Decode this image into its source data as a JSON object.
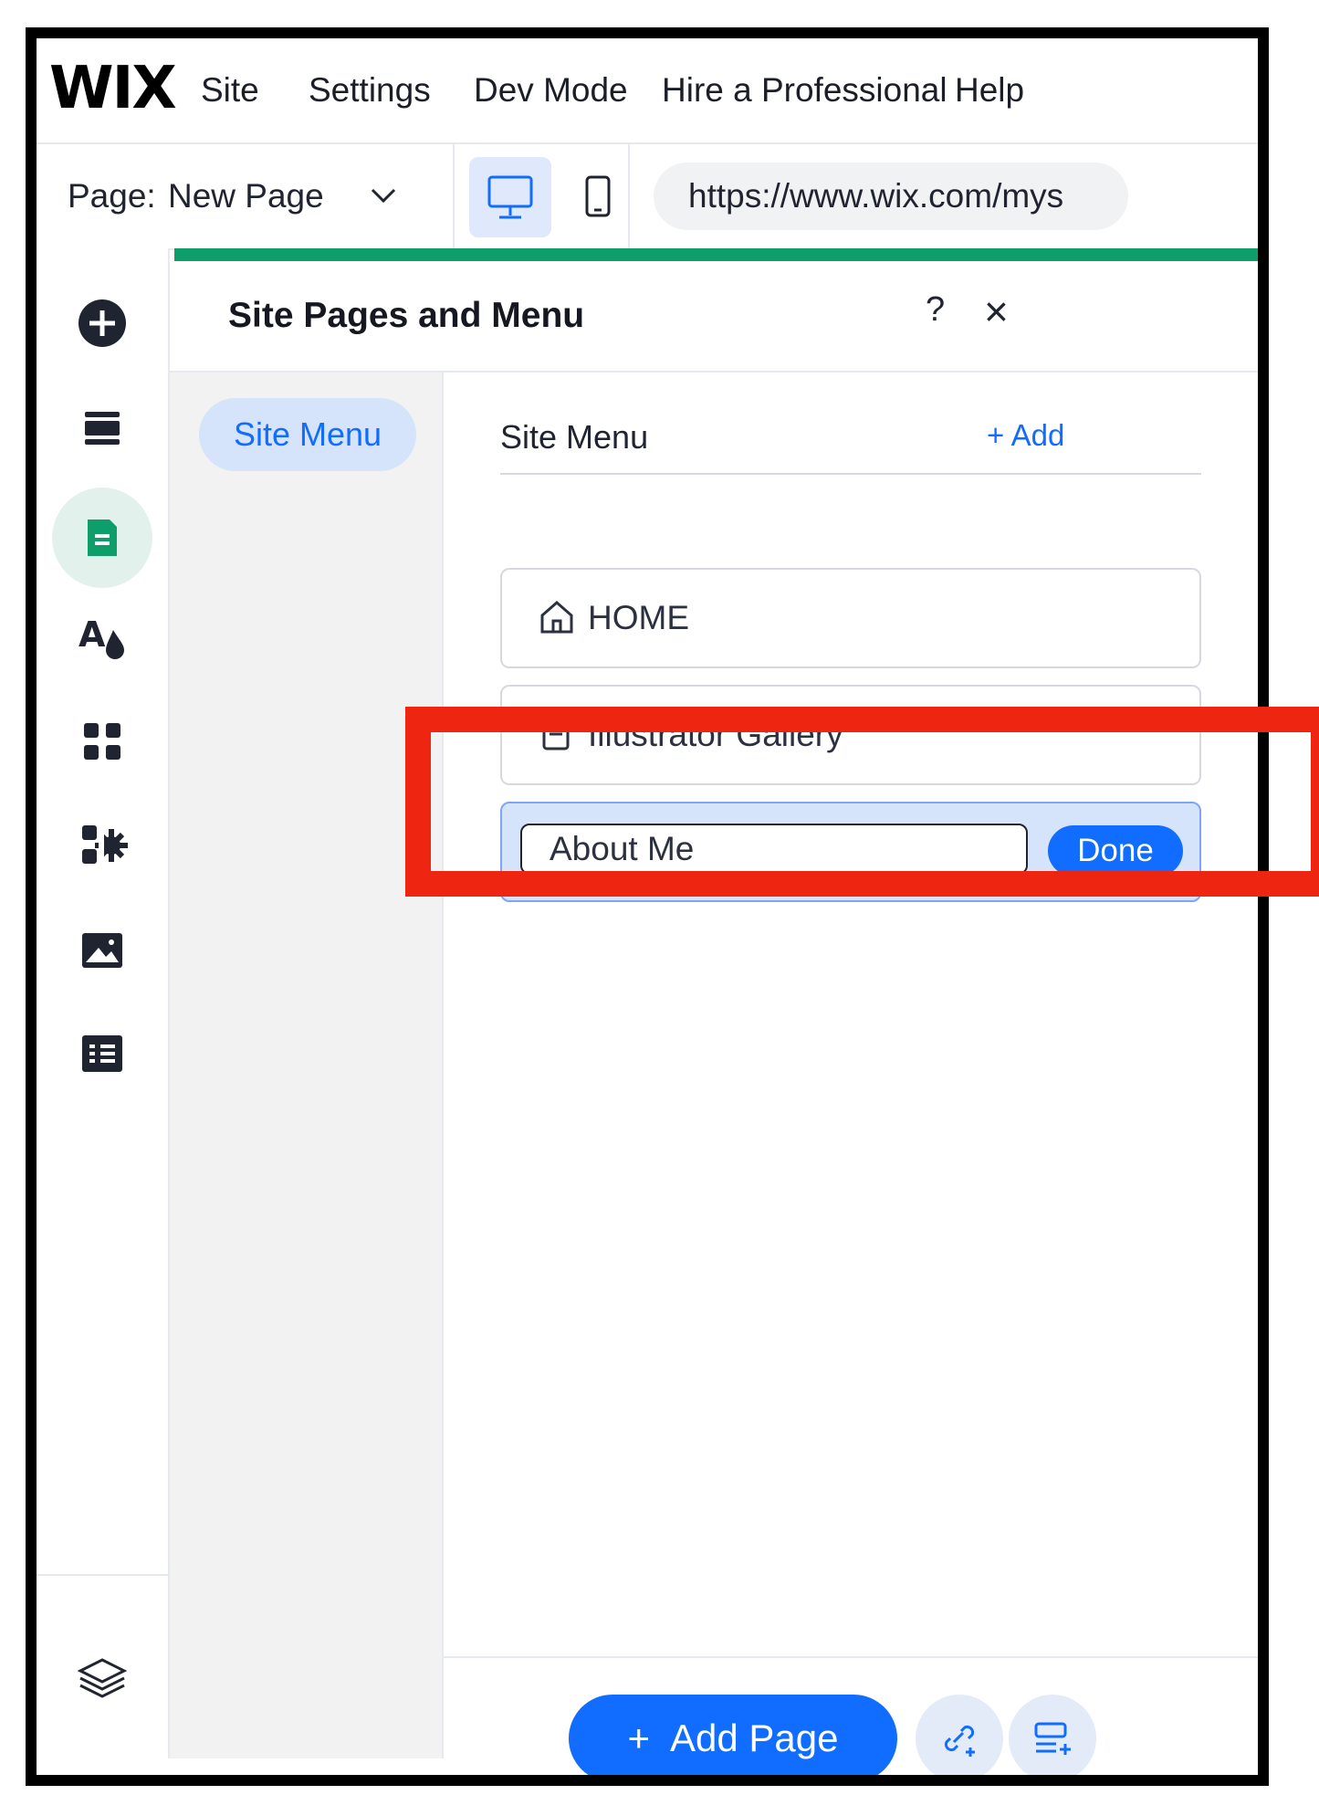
{
  "app": {
    "logo": "WIX",
    "menu": [
      "Site",
      "Settings",
      "Dev Mode",
      "Hire a Professional",
      "Help"
    ]
  },
  "pagebar": {
    "label": "Page:",
    "current_page": "New Page",
    "url": "https://www.wix.com/mys"
  },
  "leftbar": {
    "icons": [
      "add-icon",
      "sections-icon",
      "pages-icon",
      "theme-icon",
      "apps-icon",
      "business-apps-icon",
      "media-icon",
      "cms-icon",
      "layers-icon"
    ],
    "active": "pages-icon"
  },
  "panel": {
    "title": "Site Pages and Menu",
    "help": "?",
    "close": "×",
    "side_tab": "Site Menu",
    "menu_heading": "Site Menu",
    "add_label": "+ Add",
    "items": [
      {
        "icon": "home-icon",
        "label": "HOME"
      },
      {
        "icon": "page-icon",
        "label": "Illustrator Gallery"
      }
    ],
    "edit_value": "About Me",
    "done_label": "Done",
    "add_page_label": "Add Page",
    "add_page_plus": "+"
  },
  "colors": {
    "accent": "#116dff",
    "active_green": "#0e9e6b",
    "highlight_red": "#ee2611"
  }
}
